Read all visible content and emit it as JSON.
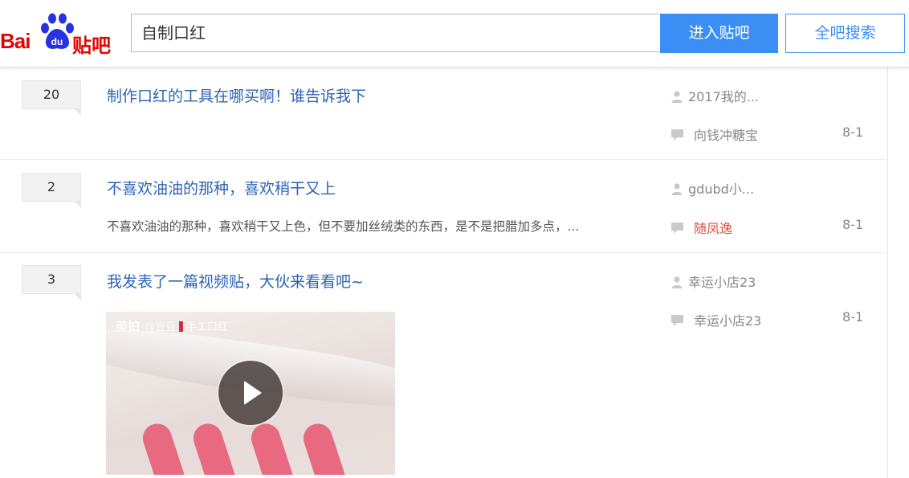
{
  "header": {
    "logo_bai": "Bai",
    "logo_du": "du",
    "logo_tieba": "贴吧",
    "search_value": "自制口红",
    "enter_button": "进入贴吧",
    "search_all_button": "全吧搜索"
  },
  "threads": [
    {
      "reply_count": "20",
      "title": "制作口红的工具在哪买啊！谁告诉我下",
      "abstract": "",
      "author": "2017我的...",
      "last_reply_by": "向钱冲糖宝",
      "last_reply_time": "8-1"
    },
    {
      "reply_count": "2",
      "title": "不喜欢油油的那种，喜欢稍干又上",
      "abstract": "不喜欢油油的那种，喜欢稍干又上色，但不要加丝绒类的东西，是不是把腊加多点，...",
      "author": "gdubd小...",
      "last_reply_by": "随凤逸",
      "last_reply_time": "8-1"
    },
    {
      "reply_count": "3",
      "title": "我发表了一篇视频贴，大伙来看看吧~",
      "abstract": "",
      "author": "幸运小店23",
      "last_reply_by": "幸运小店23",
      "last_reply_time": "8-1",
      "video": {
        "watermark_brand": "美拍",
        "watermark_text": "@豆豆",
        "watermark_suffix": "手工口红"
      }
    }
  ],
  "colors": {
    "title_link": "#2d64b3",
    "button_blue": "#3b8ef3",
    "highlight_name": "#e64a3c",
    "logo_red": "#e10602",
    "paw_blue": "#2932e1"
  },
  "icons": [
    "user-icon",
    "comment-bubble-icon",
    "play-icon",
    "baidu-paw-icon"
  ]
}
